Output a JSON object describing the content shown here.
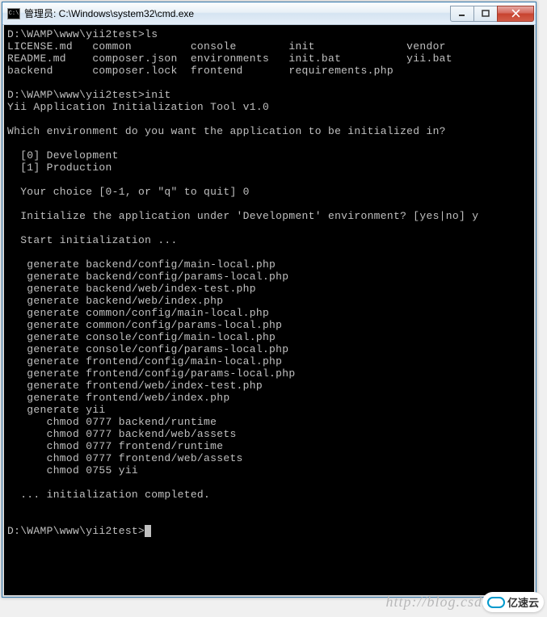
{
  "window": {
    "title": "管理员: C:\\Windows\\system32\\cmd.exe"
  },
  "terminal": {
    "prompt1": "D:\\WAMP\\www\\yii2test>",
    "cmd1": "ls",
    "ls_output": "LICENSE.md   common         console        init              vendor\nREADME.md    composer.json  environments   init.bat          yii.bat\nbackend      composer.lock  frontend       requirements.php",
    "prompt2": "D:\\WAMP\\www\\yii2test>",
    "cmd2": "init",
    "tool_header": "Yii Application Initialization Tool v1.0",
    "question1": "Which environment do you want the application to be initialized in?",
    "options": "  [0] Development\n  [1] Production",
    "choice_line": "  Your choice [0-1, or \"q\" to quit] 0",
    "confirm_line": "  Initialize the application under 'Development' environment? [yes|no] y",
    "start_line": "  Start initialization ...",
    "generate_lines": "   generate backend/config/main-local.php\n   generate backend/config/params-local.php\n   generate backend/web/index-test.php\n   generate backend/web/index.php\n   generate common/config/main-local.php\n   generate common/config/params-local.php\n   generate console/config/main-local.php\n   generate console/config/params-local.php\n   generate frontend/config/main-local.php\n   generate frontend/config/params-local.php\n   generate frontend/web/index-test.php\n   generate frontend/web/index.php\n   generate yii\n      chmod 0777 backend/runtime\n      chmod 0777 backend/web/assets\n      chmod 0777 frontend/runtime\n      chmod 0777 frontend/web/assets\n      chmod 0755 yii",
    "completed": "  ... initialization completed.",
    "prompt3": "D:\\WAMP\\www\\yii2test>"
  },
  "watermark": "http://blog.csdn",
  "logo_text": "亿速云"
}
